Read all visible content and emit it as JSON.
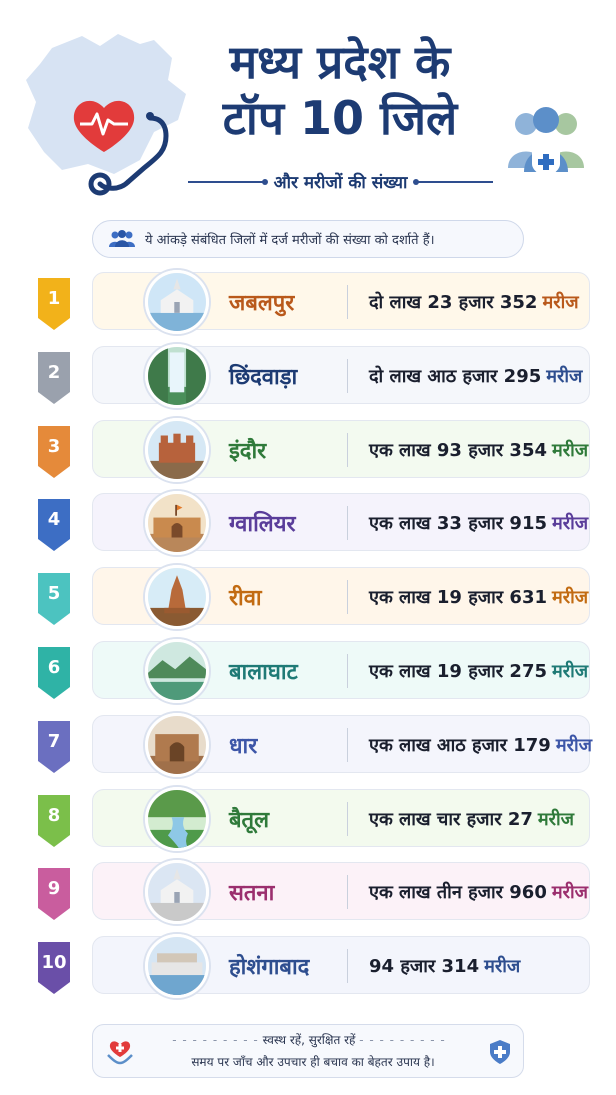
{
  "header": {
    "title_line1": "मध्य प्रदेश के",
    "title_line2": "टॉप 10 जिले",
    "subtitle": "और मरीजों की संख्या"
  },
  "note": {
    "text": "ये आंकड़े संबंधित जिलों में दर्ज मरीजों की संख्या को दर्शाते हैं।"
  },
  "districts": [
    {
      "rank": "1",
      "name": "जबलपुर",
      "count": "दो लाख 23 हजार 352",
      "unit": "मरीज",
      "color": "#f2b21a",
      "name_color": "#b9591b",
      "card_bg": "#fff8ea",
      "unit_color": "#b9591b"
    },
    {
      "rank": "2",
      "name": "छिंदवाड़ा",
      "count": "दो लाख आठ हजार 295",
      "unit": "मरीज",
      "color": "#9aa1ad",
      "name_color": "#1d3b73",
      "card_bg": "#f5f7fb",
      "unit_color": "#2e4e8f"
    },
    {
      "rank": "3",
      "name": "इंदौर",
      "count": "एक लाख 93 हजार 354",
      "unit": "मरीज",
      "color": "#e58a3a",
      "name_color": "#2f7a3a",
      "card_bg": "#f3faf0",
      "unit_color": "#2f7a3a"
    },
    {
      "rank": "4",
      "name": "ग्वालियर",
      "count": "एक लाख 33 हजार 915",
      "unit": "मरीज",
      "color": "#3d6ec4",
      "name_color": "#5a3d9a",
      "card_bg": "#f5f3fc",
      "unit_color": "#5a3d9a"
    },
    {
      "rank": "5",
      "name": "रीवा",
      "count": "एक लाख 19 हजार 631",
      "unit": "मरीज",
      "color": "#4cc3c0",
      "name_color": "#c26b12",
      "card_bg": "#fff6ea",
      "unit_color": "#c26b12"
    },
    {
      "rank": "6",
      "name": "बालाघाट",
      "count": "एक लाख 19 हजार 275",
      "unit": "मरीज",
      "color": "#2fb3a6",
      "name_color": "#1f7a76",
      "card_bg": "#eefaf8",
      "unit_color": "#1f7a76"
    },
    {
      "rank": "7",
      "name": "धार",
      "count": "एक लाख आठ हजार 179",
      "unit": "मरीज",
      "color": "#6b6fc0",
      "name_color": "#3d56a8",
      "card_bg": "#f4f5fc",
      "unit_color": "#3d56a8"
    },
    {
      "rank": "8",
      "name": "बैतूल",
      "count": "एक लाख चार हजार 27",
      "unit": "मरीज",
      "color": "#7bbf4a",
      "name_color": "#2f7a3a",
      "card_bg": "#f3faee",
      "unit_color": "#2f7a3a"
    },
    {
      "rank": "9",
      "name": "सतना",
      "count": "एक लाख तीन हजार 960",
      "unit": "मरीज",
      "color": "#c95d9e",
      "name_color": "#9b2f6e",
      "card_bg": "#fcf2f8",
      "unit_color": "#9b2f6e"
    },
    {
      "rank": "10",
      "name": "होशंगाबाद",
      "count": "94 हजार 314",
      "unit": "मरीज",
      "color": "#6a4fa8",
      "name_color": "#2e4e8f",
      "card_bg": "#f3f5fc",
      "unit_color": "#2e4e8f"
    }
  ],
  "footer": {
    "line1": "स्वस्थ रहें, सुरक्षित रहें",
    "line2": "समय पर जाँच और उपचार ही बचाव का बेहतर उपाय है।"
  },
  "icons": {
    "map": "madhya-pradesh-map-icon",
    "heart": "heart-icon",
    "stethoscope": "stethoscope-icon",
    "people": "medical-people-icon",
    "note": "people-icon",
    "footer_left": "heart-hands-icon",
    "footer_right": "shield-plus-icon"
  }
}
